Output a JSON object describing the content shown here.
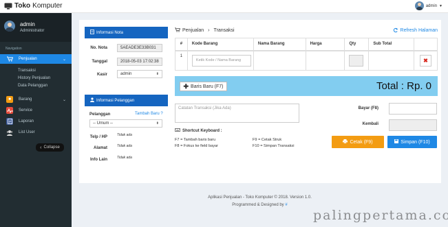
{
  "app": {
    "title_bold": "Toko",
    "title_rest": "Komputer",
    "user_menu_name": "admin"
  },
  "sidebar": {
    "user_name": "admin",
    "user_role": "Administrator",
    "nav_header": "Navigation",
    "items": [
      {
        "label": "Penjualan",
        "icon": "cart-icon",
        "active": true
      },
      {
        "label": "Barang",
        "icon": "box-icon",
        "color": "#f39c12"
      },
      {
        "label": "Service",
        "icon": "pulse-icon",
        "color": "#e74c3c"
      },
      {
        "label": "Laporan",
        "icon": "report-icon",
        "color": "#3c5a99"
      },
      {
        "label": "List User",
        "icon": "users-icon",
        "color": "#d0d0d0"
      }
    ],
    "sub_items": [
      "Transaksi",
      "History Penjualan",
      "Data Pelanggan"
    ],
    "collapse_label": "Collapse"
  },
  "nota": {
    "header": "Informasi Nota",
    "no_nota_label": "No. Nota",
    "no_nota_value": "5AEADE3E33B031",
    "tanggal_label": "Tanggal",
    "tanggal_value": "2018-05-03 17:02:38",
    "kasir_label": "Kasir",
    "kasir_value": "admin"
  },
  "pelanggan": {
    "header": "Informasi Pelanggan",
    "pelanggan_label": "Pelanggan",
    "tambah_link": "Tambah Baru ?",
    "select_value": "-- Umum --",
    "telp_label": "Telp / HP",
    "telp_value": "Tidak ada",
    "alamat_label": "Alamat",
    "alamat_value": "Tidak ada",
    "info_label": "Info Lain",
    "info_value": "Tidak ada"
  },
  "main": {
    "breadcrumb_1": "Penjualan",
    "breadcrumb_sep": "›",
    "breadcrumb_2": "Transaksi",
    "refresh_label": "Refresh Halaman",
    "table": {
      "columns": [
        "#",
        "Kode Barang",
        "Nama Barang",
        "Harga",
        "Qty",
        "Sub Total"
      ],
      "row_number": "1",
      "kode_placeholder": "Ketik Kode / Nama Barang"
    },
    "btn_baru": "Baris Baru (F7)",
    "total_text": "Total : Rp. 0",
    "note_placeholder": "Catatan Transaksi (Jika Ada)",
    "shortcut_title": "Shortcut Keyboard :",
    "shortcuts": [
      "F7 = Tambah baris baru",
      "F8 = Fokus ke field bayar",
      "F9 = Cetak Struk",
      "F10 = Simpan Transaksi"
    ],
    "bayar_label": "Bayar (F8)",
    "kembali_label": "Kembali",
    "btn_cetak": "Cetak (F9)",
    "btn_simpan": "Simpan (F10)"
  },
  "footer": {
    "line1": "Aplikasi Penjualan - Toko Komputer © 2018. Version 1.0.",
    "line2_prefix": "Programmed & Designed by",
    "line2_link": "#"
  },
  "watermark": "palingpertama.com",
  "colors": {
    "primary": "#1565c0",
    "accent": "#1e88e5",
    "warning": "#f39c12",
    "sidebar": "#222d32",
    "total_bar": "#82cdf0"
  }
}
